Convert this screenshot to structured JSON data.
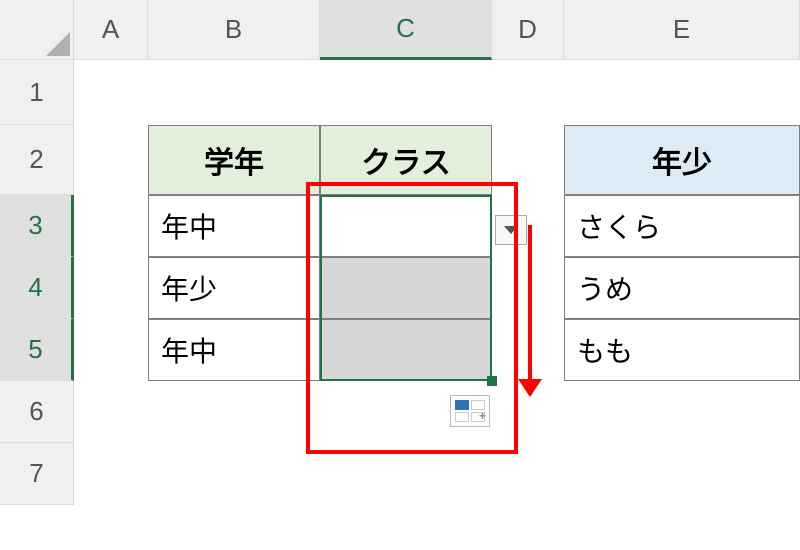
{
  "columns": {
    "A": "A",
    "B": "B",
    "C": "C",
    "D": "D",
    "E": "E"
  },
  "rows": {
    "r1": "1",
    "r2": "2",
    "r3": "3",
    "r4": "4",
    "r5": "5",
    "r6": "6",
    "r7": "7"
  },
  "headers": {
    "grade": "学年",
    "class_": "クラス",
    "youngest": "年少"
  },
  "grade": {
    "r3": "年中",
    "r4": "年少",
    "r5": "年中"
  },
  "listE": {
    "r3": "さくら",
    "r4": "うめ",
    "r5": "もも"
  },
  "selection": {
    "active_cell": "C3",
    "range": "C3:C5",
    "active_column": "C",
    "active_rows": [
      "3",
      "4",
      "5"
    ]
  },
  "colors": {
    "excel_green": "#217346",
    "header_green": "#e2efda",
    "header_blue": "#ddebf7",
    "annotation_red": "#ff0000"
  }
}
